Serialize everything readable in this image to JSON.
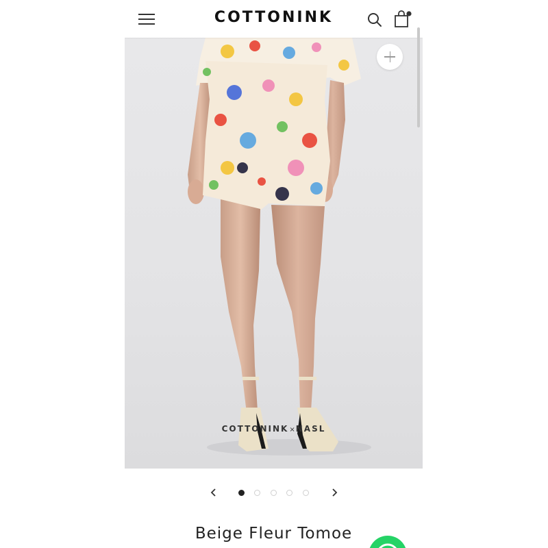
{
  "header": {
    "logo": "COTTONINK",
    "menu_icon": "hamburger-menu-icon",
    "search_icon": "search-icon",
    "cart_icon": "shopping-bag-icon"
  },
  "product_image": {
    "zoom_icon": "plus-icon",
    "watermark": {
      "brand": "COTTONINK",
      "separator": "×",
      "collab": "NASL"
    }
  },
  "carousel": {
    "prev_icon": "chevron-left-icon",
    "next_icon": "chevron-right-icon",
    "slides": 5,
    "active_index": 0
  },
  "product": {
    "title": "Beige Fleur Tomoe"
  },
  "chat_button": {
    "icon": "whatsapp-icon"
  },
  "colors": {
    "background": "#ffffff",
    "photo_background": "#e6e6e8",
    "dot_active": "#222222",
    "dot_inactive": "#cfcfcf",
    "whatsapp": "#25d366"
  }
}
